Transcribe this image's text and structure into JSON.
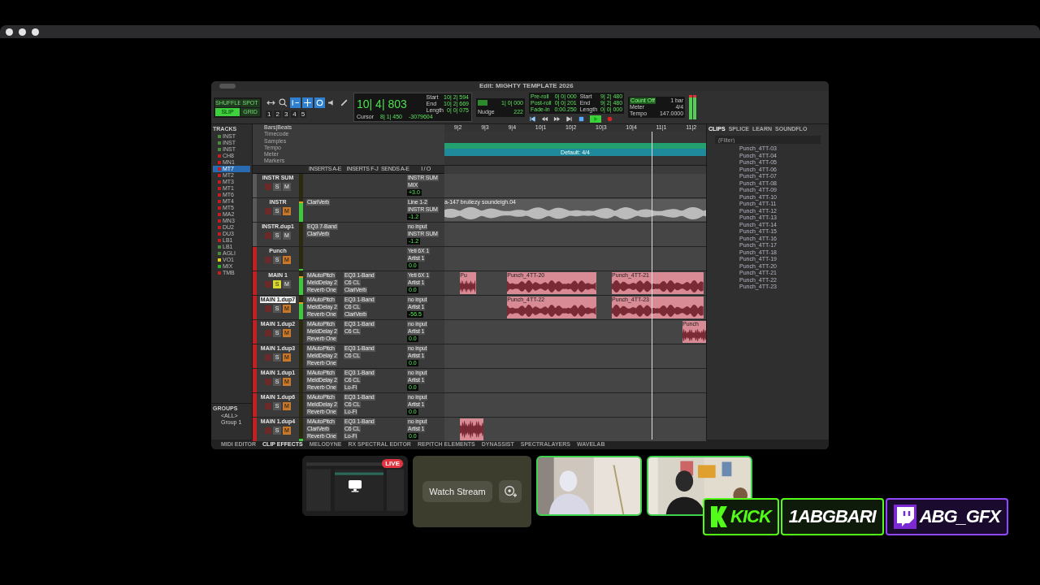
{
  "window": {
    "title": "Edit: MIGHTY TEMPLATE 2026"
  },
  "toolbar": {
    "modes": [
      {
        "label": "SHUFFLE",
        "selected": false
      },
      {
        "label": "SPOT",
        "selected": false
      },
      {
        "label": "SLIP",
        "selected": true
      },
      {
        "label": "GRID",
        "selected": false
      }
    ],
    "zoom_presets": [
      "1",
      "2",
      "3",
      "4",
      "5"
    ],
    "main_counter": "10| 4| 803",
    "selection": [
      {
        "label": "Start",
        "value": "10| 2| 594"
      },
      {
        "label": "End",
        "value": "10| 2| 669"
      },
      {
        "label": "Length",
        "value": "0| 0| 075"
      }
    ],
    "cursor_label": "Cursor",
    "cursor_value": "8| 1| 450",
    "sample_value": "-3079604",
    "grid_value": "1| 0| 000",
    "nudge_label": "Nudge",
    "nudge_value": "222",
    "rolls": [
      {
        "label": "Pre-roll",
        "value": "0| 0| 000"
      },
      {
        "label": "Post-roll",
        "value": "0| 0| 201"
      },
      {
        "label": "Fade-in",
        "value": "0:00.250"
      }
    ],
    "transport_selection": [
      {
        "label": "Start",
        "value": "9| 2| 480"
      },
      {
        "label": "End",
        "value": "9| 2| 480"
      },
      {
        "label": "Length",
        "value": "0| 0| 000"
      }
    ],
    "count_off": "Count Off",
    "bar": "1 bar",
    "meter_label": "Meter",
    "meter_value": "4/4",
    "tempo_label": "Tempo",
    "tempo_value": "147.0000"
  },
  "tracks_panel": {
    "title": "TRACKS",
    "items": [
      {
        "name": "INST",
        "color": "#4a8a3a",
        "selected": false
      },
      {
        "name": "INST",
        "color": "#4a8a3a",
        "selected": false
      },
      {
        "name": "INST",
        "color": "#4a8a3a",
        "selected": false
      },
      {
        "name": "CH8",
        "color": "#c02020",
        "selected": false
      },
      {
        "name": "MN1",
        "color": "#c02020",
        "selected": false
      },
      {
        "name": "MT7",
        "color": "#c02020",
        "selected": true
      },
      {
        "name": "MT2",
        "color": "#c02020",
        "selected": false
      },
      {
        "name": "MT3",
        "color": "#c02020",
        "selected": false
      },
      {
        "name": "MT1",
        "color": "#c02020",
        "selected": false
      },
      {
        "name": "MT6",
        "color": "#c02020",
        "selected": false
      },
      {
        "name": "MT4",
        "color": "#c02020",
        "selected": false
      },
      {
        "name": "MT5",
        "color": "#c02020",
        "selected": false
      },
      {
        "name": "MA2",
        "color": "#c02020",
        "selected": false
      },
      {
        "name": "MN3",
        "color": "#c02020",
        "selected": false
      },
      {
        "name": "DU2",
        "color": "#c02020",
        "selected": false
      },
      {
        "name": "DU3",
        "color": "#c02020",
        "selected": false
      },
      {
        "name": "LB1",
        "color": "#c02020",
        "selected": false
      },
      {
        "name": "LB1",
        "color": "#4a8a3a",
        "selected": false
      },
      {
        "name": "AGLI",
        "color": "#4a8a3a",
        "selected": false
      },
      {
        "name": "VO1",
        "color": "#e0d020",
        "selected": false
      },
      {
        "name": "MIX",
        "color": "#30b030",
        "selected": false
      },
      {
        "name": "TMB",
        "color": "#c02020",
        "selected": false
      }
    ]
  },
  "groups_panel": {
    "title": "GROUPS",
    "items": [
      "<ALL>",
      "Group 1"
    ]
  },
  "rulers": {
    "names": [
      "Bars|Beats",
      "Timecode",
      "Samples",
      "Tempo",
      "Meter",
      "Markers"
    ],
    "bars": [
      "9|2",
      "9|3",
      "9|4",
      "10|1",
      "10|2",
      "10|3",
      "10|4",
      "11|1",
      "11|2"
    ],
    "meter_marker": "Default: 4/4"
  },
  "columns": [
    "INSERTS A-E",
    "INSERTS F-J",
    "SENDS A-E",
    "I / O"
  ],
  "tracks": [
    {
      "name": "INSTR SUM",
      "color": "#5a5a5a",
      "selected": false,
      "muted": false,
      "soloed": false,
      "solo": "S",
      "mute": "M",
      "input": "INSTR SUM",
      "output": "MIX",
      "volume": "+3.0"
    },
    {
      "name": "INSTR",
      "color": "#5a5a5a",
      "selected": false,
      "muted": true,
      "soloed": false,
      "solo": "S",
      "mute": "M",
      "inserts": [
        "ClariVerb"
      ],
      "input": "Line 1-2",
      "output": "INSTR SUM",
      "volume": "-1.2",
      "level": 0.85,
      "clips": [
        {
          "name": "a-147 bruliezy soundeigh.04",
          "kind": "audio"
        }
      ]
    },
    {
      "name": "INSTR.dup1",
      "color": "#5a5a5a",
      "selected": false,
      "muted": false,
      "soloed": false,
      "solo": "S",
      "mute": "M",
      "inserts": [
        "EQ3 7-Band",
        "ClariVerb"
      ],
      "input": "no input",
      "output": "INSTR SUM",
      "volume": "-1.2"
    },
    {
      "name": "Punch",
      "color": "#c02020",
      "selected": false,
      "muted": true,
      "soloed": false,
      "solo": "S",
      "mute": "M",
      "input": "Yeti 6X 1",
      "output": "Artist 1",
      "volume": "0.0",
      "level": 0.05
    },
    {
      "name": "MAIN 1",
      "color": "#c02020",
      "selected": false,
      "muted": false,
      "soloed": true,
      "solo": "S",
      "mute": "M",
      "inserts": [
        "MAutoPitch",
        "MeldDelay 2",
        "Reverb One"
      ],
      "inserts_2": [
        "EQ3 1-Band",
        "C6 CL",
        "ClariVerb"
      ],
      "input": "Yeti 6X 1",
      "output": "Artist 1",
      "volume": "0.0",
      "level": 0.8,
      "clips": [
        {
          "name": "Pu",
          "kind": "vocal"
        },
        {
          "name": "Punch_4TT-20",
          "kind": "vocal"
        },
        {
          "name": "Punch_4TT-21",
          "kind": "vocal"
        }
      ]
    },
    {
      "name": "MAIN 1.dup7",
      "color": "#c02020",
      "selected": true,
      "muted": true,
      "soloed": false,
      "solo": "S",
      "mute": "M",
      "inserts": [
        "MAutoPitch",
        "MeldDelay 2",
        "Reverb One"
      ],
      "inserts_2": [
        "EQ3 1-Band",
        "C6 CL",
        "ClariVerb"
      ],
      "input": "no input",
      "output": "Artist 1",
      "volume": "-56.5",
      "level": 0.7,
      "clips": [
        {
          "name": "Punch_4TT-22",
          "kind": "vocal"
        },
        {
          "name": "Punch_4TT-23",
          "kind": "vocal"
        }
      ]
    },
    {
      "name": "MAIN 1.dup2",
      "color": "#c02020",
      "selected": false,
      "muted": true,
      "soloed": false,
      "solo": "S",
      "mute": "M",
      "inserts": [
        "MAutoPitch",
        "MeldDelay 2",
        "Reverb One"
      ],
      "inserts_2": [
        "EQ3 1-Band",
        "C6 CL"
      ],
      "input": "no input",
      "output": "Artist 1",
      "volume": "0.0",
      "clips": [
        {
          "name": "Punch",
          "kind": "vocal"
        }
      ]
    },
    {
      "name": "MAIN 1.dup3",
      "color": "#c02020",
      "selected": false,
      "muted": true,
      "soloed": false,
      "solo": "S",
      "mute": "M",
      "inserts": [
        "MAutoPitch",
        "MeldDelay 2",
        "Reverb One"
      ],
      "inserts_2": [
        "EQ3 1-Band",
        "C6 CL"
      ],
      "input": "no input",
      "output": "Artist 1",
      "volume": "0.0"
    },
    {
      "name": "MAIN 1.dup1",
      "color": "#c02020",
      "selected": false,
      "muted": true,
      "soloed": false,
      "solo": "S",
      "mute": "M",
      "inserts": [
        "MAutoPitch",
        "MeldDelay 2",
        "Reverb One"
      ],
      "inserts_2": [
        "EQ3 1-Band",
        "C6 CL",
        "Lo-Fi"
      ],
      "input": "no input",
      "output": "Artist 1",
      "volume": "0.0"
    },
    {
      "name": "MAIN 1.dup6",
      "color": "#c02020",
      "selected": false,
      "muted": true,
      "soloed": false,
      "solo": "S",
      "mute": "M",
      "inserts": [
        "MAutoPitch",
        "MeldDelay 2",
        "Reverb One"
      ],
      "inserts_2": [
        "EQ3 1-Band",
        "C6 CL",
        "Lo-Fi"
      ],
      "input": "no input",
      "output": "Artist 1",
      "volume": "0.0"
    },
    {
      "name": "MAIN 1.dup4",
      "color": "#c02020",
      "selected": false,
      "muted": true,
      "soloed": false,
      "solo": "S",
      "mute": "M",
      "inserts": [
        "MAutoPitch",
        "ClariVerb",
        "Reverb One"
      ],
      "inserts_2": [
        "EQ3 1-Band",
        "C6 CL",
        "Lo-Fi"
      ],
      "input": "no input",
      "output": "Artist 1",
      "volume": "0.0",
      "level": 0.1,
      "clips": [
        {
          "kind": "vocal"
        }
      ]
    }
  ],
  "clips_panel": {
    "tabs": [
      {
        "label": "CLIPS",
        "selected": true
      },
      {
        "label": "SPLICE",
        "selected": false
      },
      {
        "label": "LEARN",
        "selected": false
      },
      {
        "label": "SOUNDFLO",
        "selected": false
      }
    ],
    "filter_placeholder": "(Filter)",
    "items": [
      "Punch_4TT-03",
      "Punch_4TT-04",
      "Punch_4TT-05",
      "Punch_4TT-06",
      "Punch_4TT-07",
      "Punch_4TT-08",
      "Punch_4TT-09",
      "Punch_4TT-10",
      "Punch_4TT-11",
      "Punch_4TT-12",
      "Punch_4TT-13",
      "Punch_4TT-14",
      "Punch_4TT-15",
      "Punch_4TT-16",
      "Punch_4TT-17",
      "Punch_4TT-18",
      "Punch_4TT-19",
      "Punch_4TT-20",
      "Punch_4TT-21",
      "Punch_4TT-22",
      "Punch_4TT-23"
    ]
  },
  "bottom_tabs": [
    {
      "label": "MIDI EDITOR",
      "selected": false
    },
    {
      "label": "CLIP EFFECTS",
      "selected": true
    },
    {
      "label": "MELODYNE",
      "selected": false
    },
    {
      "label": "RX SPECTRAL EDITOR",
      "selected": false
    },
    {
      "label": "REPITCH ELEMENTS",
      "selected": false
    },
    {
      "label": "DYNASSIST",
      "selected": false
    },
    {
      "label": "SPECTRALAYERS",
      "selected": false
    },
    {
      "label": "WAVELAB",
      "selected": false
    }
  ],
  "participants": [
    {
      "kind": "screen",
      "badge": "LIVE"
    },
    {
      "kind": "watch",
      "button": "Watch Stream"
    },
    {
      "kind": "camera",
      "speaking": true
    },
    {
      "kind": "camera",
      "speaking": true
    }
  ],
  "overlay": {
    "kick": "KICK",
    "name": "1ABGBARI",
    "twitch": "ABG_GFX"
  }
}
